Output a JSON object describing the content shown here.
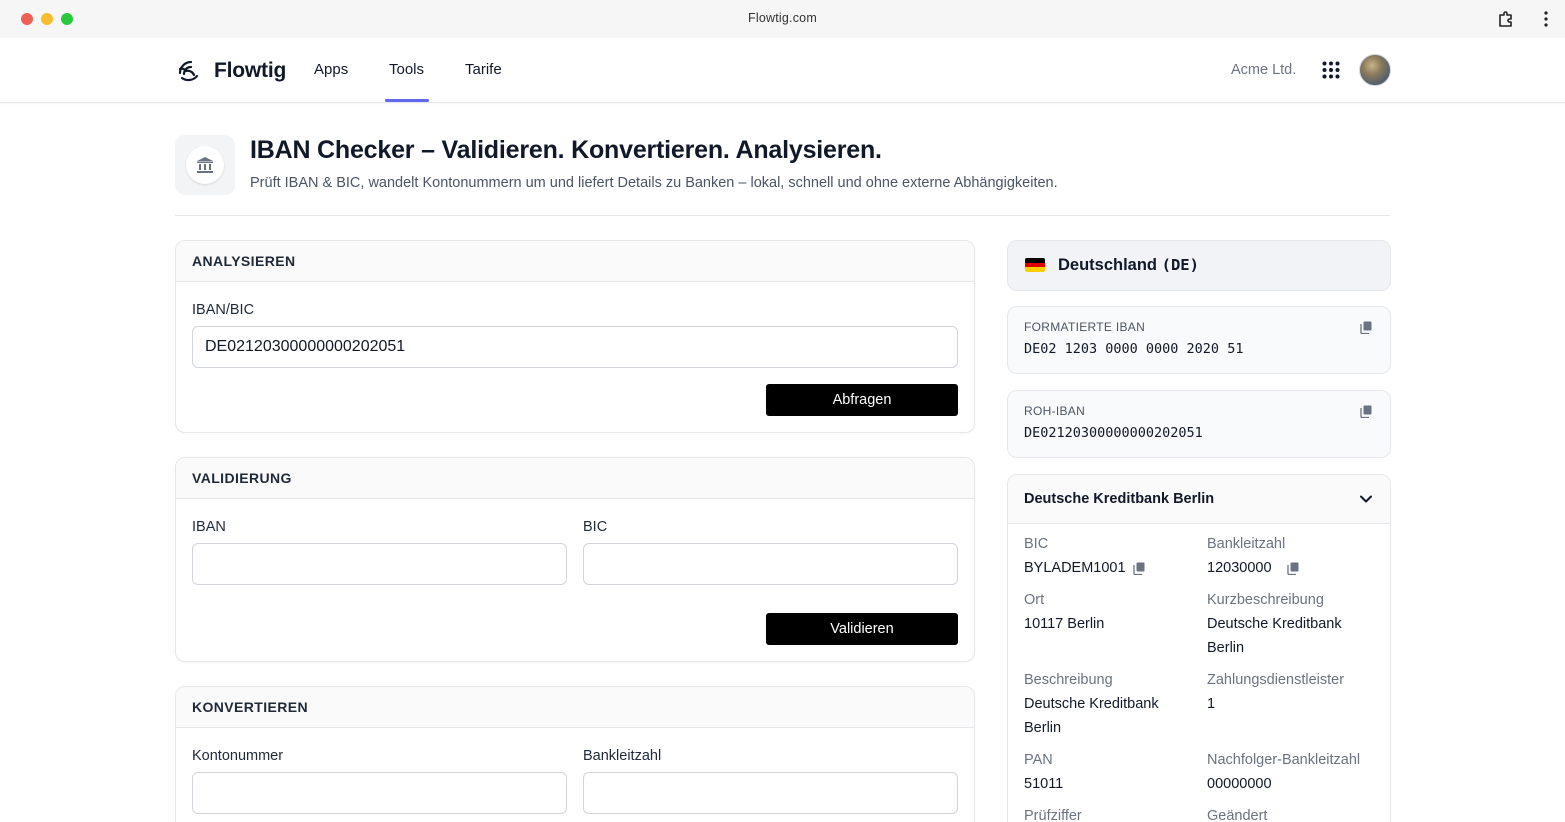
{
  "browser": {
    "url": "Flowtig.com"
  },
  "nav": {
    "logo_text": "Flowtig",
    "items": [
      {
        "label": "Apps"
      },
      {
        "label": "Tools",
        "active": true
      },
      {
        "label": "Tarife"
      }
    ],
    "company": "Acme Ltd.",
    "accent_color": "#6366f1"
  },
  "page": {
    "title": "IBAN Checker – Validieren. Konvertieren. Analysieren.",
    "subtitle": "Prüft IBAN & BIC, wandelt Kontonummern um und liefert Details zu Banken – lokal, schnell und ohne externe Abhängigkeiten.",
    "icon": "bank-icon"
  },
  "analyse": {
    "heading": "ANALYSIEREN",
    "field_label": "IBAN/BIC",
    "field_value": "DE02120300000000202051",
    "button": "Abfragen"
  },
  "validation": {
    "heading": "VALIDIERUNG",
    "iban_label": "IBAN",
    "iban_value": "",
    "bic_label": "BIC",
    "bic_value": "",
    "button": "Validieren"
  },
  "convert": {
    "heading": "KONVERTIEREN",
    "account_label": "Kontonummer",
    "account_value": "",
    "blz_label": "Bankleitzahl",
    "blz_value": ""
  },
  "result": {
    "country_name": "Deutschland",
    "country_code": "(DE)",
    "formatted_iban_label": "FORMATIERTE IBAN",
    "formatted_iban": "DE02 1203 0000 0000 2020 51",
    "raw_iban_label": "ROH-IBAN",
    "raw_iban": "DE02120300000000202051",
    "bank": {
      "name": "Deutsche Kreditbank Berlin",
      "fields": {
        "bic_label": "BIC",
        "bic": "BYLADEM1001",
        "blz_label": "Bankleitzahl",
        "blz": "12030000",
        "ort_label": "Ort",
        "ort": "10117 Berlin",
        "kurz_label": "Kurzbeschreibung",
        "kurz": "Deutsche Kreditbank Berlin",
        "beschreibung_label": "Beschreibung",
        "beschreibung": "Deutsche Kreditbank Berlin",
        "zahlungs_label": "Zahlungsdienstleister",
        "zahlungs": "1",
        "pan_label": "PAN",
        "pan": "51011",
        "nachfolger_label": "Nachfolger-Bankleitzahl",
        "nachfolger": "00000000",
        "pruef_label": "Prüfziffer",
        "geaendert_label": "Geändert"
      }
    }
  }
}
